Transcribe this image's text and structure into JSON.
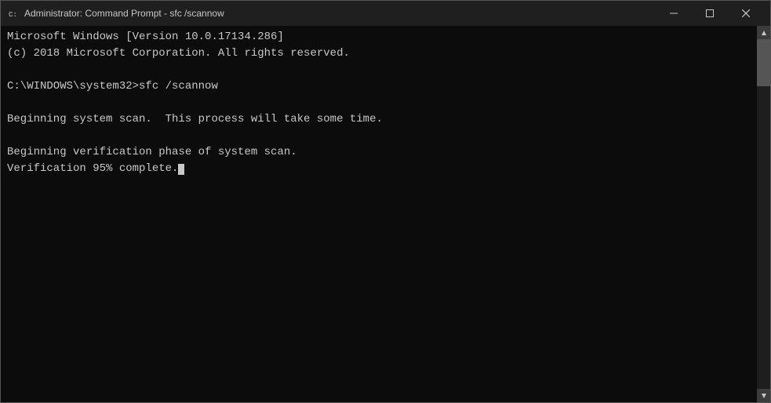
{
  "window": {
    "title": "Administrator: Command Prompt - sfc /scannow",
    "icon": "cmd-icon"
  },
  "titlebar": {
    "minimize_label": "─",
    "maximize_label": "□",
    "close_label": "✕"
  },
  "terminal": {
    "lines": [
      "Microsoft Windows [Version 10.0.17134.286]",
      "(c) 2018 Microsoft Corporation. All rights reserved.",
      "",
      "C:\\WINDOWS\\system32>sfc /scannow",
      "",
      "Beginning system scan.  This process will take some time.",
      "",
      "Beginning verification phase of system scan.",
      "Verification 95% complete."
    ]
  }
}
